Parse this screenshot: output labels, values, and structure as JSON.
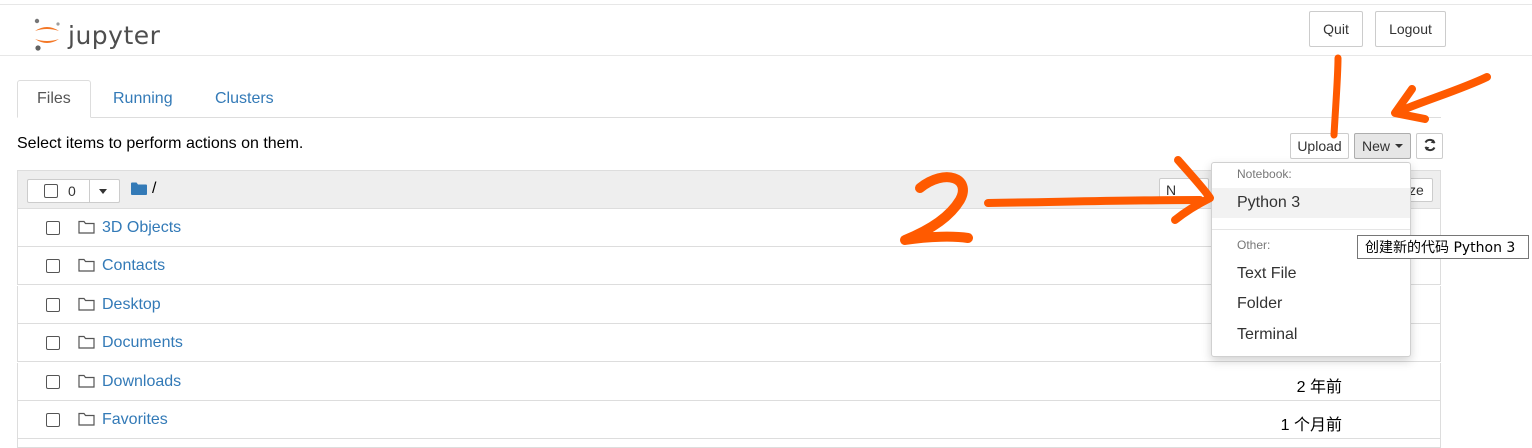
{
  "app": {
    "logo_text": "jupyter"
  },
  "header": {
    "quit_label": "Quit",
    "logout_label": "Logout"
  },
  "tabs": [
    {
      "label": "Files",
      "active": true
    },
    {
      "label": "Running",
      "active": false
    },
    {
      "label": "Clusters",
      "active": false
    }
  ],
  "hint": "Select items to perform actions on them.",
  "toolbar": {
    "upload_label": "Upload",
    "new_label": "New",
    "refresh_icon": "refresh-icon"
  },
  "list_header": {
    "selected_count": "0",
    "breadcrumb": "/",
    "name_sort_partial": "N",
    "size_partial": "ze"
  },
  "files": [
    {
      "name": "3D Objects",
      "modified": ""
    },
    {
      "name": "Contacts",
      "modified": ""
    },
    {
      "name": "Desktop",
      "modified": ""
    },
    {
      "name": "Documents",
      "modified": ""
    },
    {
      "name": "Downloads",
      "modified": "2 年前"
    },
    {
      "name": "Favorites",
      "modified": "1 个月前"
    }
  ],
  "new_menu": {
    "notebook_header": "Notebook:",
    "notebook_items": [
      "Python 3"
    ],
    "other_header": "Other:",
    "other_items": [
      "Text File",
      "Folder",
      "Terminal"
    ]
  },
  "tooltip": "创建新的代码 Python 3",
  "annotations": {
    "marker_1": "1",
    "marker_2": "2",
    "color": "#ff5a00"
  },
  "colors": {
    "link": "#337ab7",
    "logo_orange": "#f37726"
  }
}
